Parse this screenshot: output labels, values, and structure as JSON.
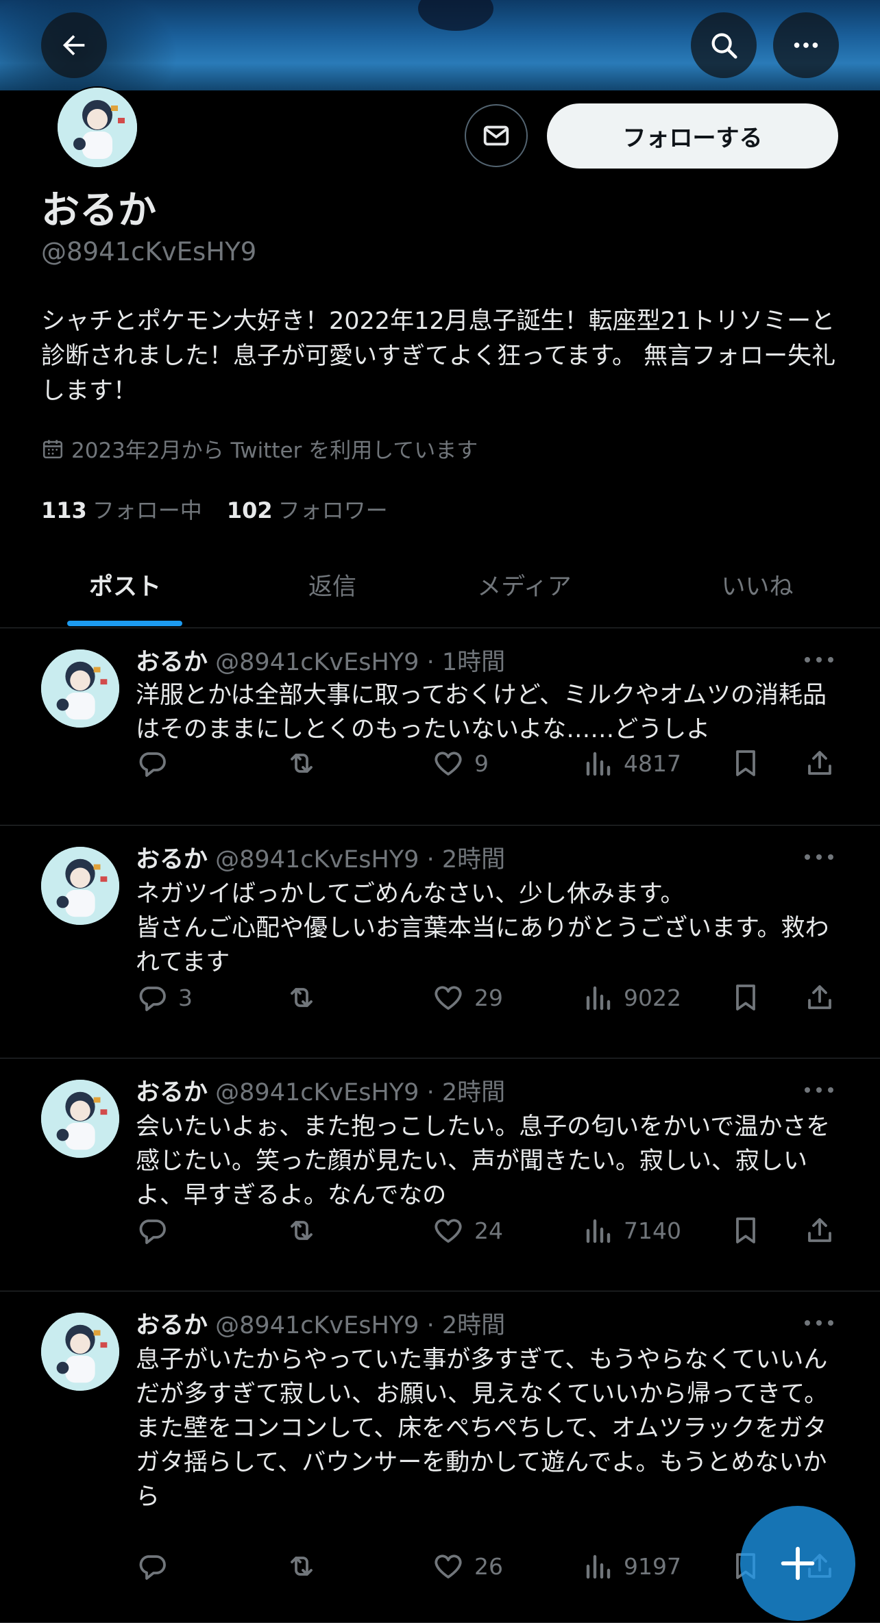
{
  "header": {
    "back_icon": "arrow-left-icon",
    "search_icon": "search-icon",
    "more_icon": "ellipsis-icon"
  },
  "profile": {
    "name": "おるか",
    "handle": "@8941cKvEsHY9",
    "follow_label": "フォローする",
    "bio": "シャチとポケモン大好き！2022年12月息子誕生！転座型21トリソミーと診断されました！息子が可愛いすぎてよく狂ってます。 無言フォロー失礼します！",
    "joined": "2023年2月から Twitter を利用しています",
    "following_count": "113",
    "following_label": "フォロー中",
    "followers_count": "102",
    "followers_label": "フォロワー"
  },
  "tabs": [
    "ポスト",
    "返信",
    "メディア",
    "いいね"
  ],
  "posts": [
    {
      "name": "おるか",
      "meta": "@8941cKvEsHY9 · 1時間",
      "text": "洋服とかは全部大事に取っておくけど、ミルクやオムツの消耗品はそのままにしとくのもったいないよな……どうしよ",
      "replies": "",
      "likes": "9",
      "views": "4817"
    },
    {
      "name": "おるか",
      "meta": "@8941cKvEsHY9 · 2時間",
      "text": "ネガツイばっかしてごめんなさい、少し休みます。\n皆さんご心配や優しいお言葉本当にありがとうございます。救われてます",
      "replies": "3",
      "likes": "29",
      "views": "9022"
    },
    {
      "name": "おるか",
      "meta": "@8941cKvEsHY9 · 2時間",
      "text": "会いたいよぉ、また抱っこしたい。息子の匂いをかいで温かさを感じたい。笑った顔が見たい、声が聞きたい。寂しい、寂しいよ、早すぎるよ。なんでなの",
      "replies": "",
      "likes": "24",
      "views": "7140"
    },
    {
      "name": "おるか",
      "meta": "@8941cKvEsHY9 · 2時間",
      "text": "息子がいたからやっていた事が多すぎて、もうやらなくていいんだが多すぎて寂しい、お願い、見えなくていいから帰ってきて。\nまた壁をコンコンして、床をぺちぺちして、オムツラックをガタガタ揺らして、バウンサーを動かして遊んでよ。もうとめないから",
      "replies": "",
      "likes": "26",
      "views": "9197"
    }
  ],
  "colors": {
    "accent": "#1d9bf0",
    "muted": "#71767b",
    "text": "#e7e9ea"
  }
}
